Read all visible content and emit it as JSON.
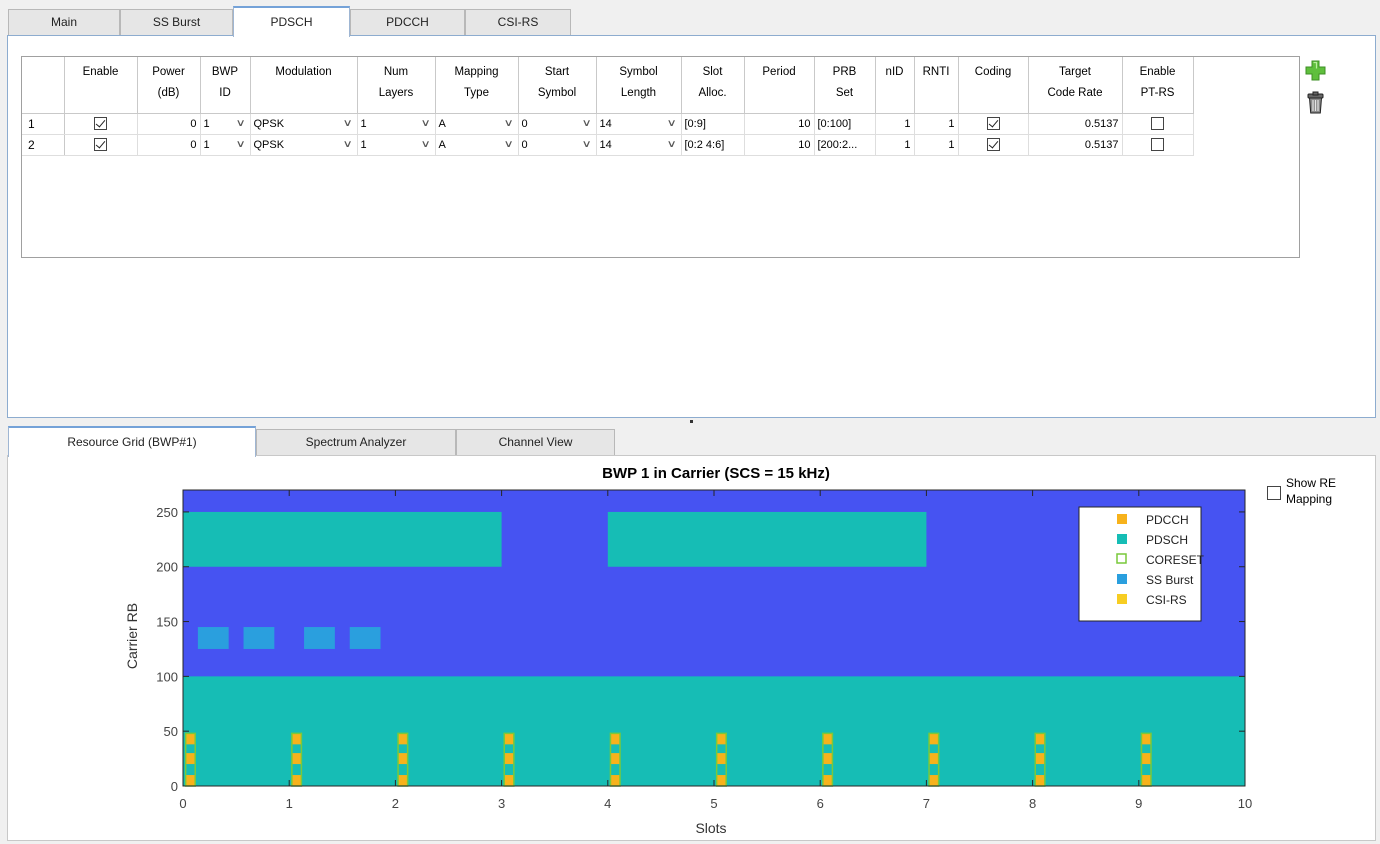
{
  "top_tabs": [
    {
      "label": "Main",
      "active": false
    },
    {
      "label": "SS Burst",
      "active": false
    },
    {
      "label": "PDSCH",
      "active": true
    },
    {
      "label": "PDCCH",
      "active": false
    },
    {
      "label": "CSI-RS",
      "active": false
    }
  ],
  "pdsch_table": {
    "headers": [
      [
        "Enable"
      ],
      [
        "Power",
        "(dB)"
      ],
      [
        "BWP",
        "ID"
      ],
      [
        "Modulation"
      ],
      [
        "Num",
        "Layers"
      ],
      [
        "Mapping",
        "Type"
      ],
      [
        "Start",
        "Symbol"
      ],
      [
        "Symbol",
        "Length"
      ],
      [
        "Slot",
        "Alloc."
      ],
      [
        "Period"
      ],
      [
        "PRB",
        "Set"
      ],
      [
        "nID"
      ],
      [
        "RNTI"
      ],
      [
        "Coding"
      ],
      [
        "Target",
        "Code Rate"
      ],
      [
        "Enable",
        "PT-RS"
      ]
    ],
    "rows": [
      {
        "row": "1",
        "enable": true,
        "power": "0",
        "bwp_id": "1",
        "modulation": "QPSK",
        "num_layers": "1",
        "mapping_type": "A",
        "start_symbol": "0",
        "symbol_length": "14",
        "slot_alloc": "[0:9]",
        "period": "10",
        "prb_set": "[0:100]",
        "nid": "1",
        "rnti": "1",
        "coding": true,
        "target_code_rate": "0.5137",
        "enable_ptrs": false
      },
      {
        "row": "2",
        "enable": true,
        "power": "0",
        "bwp_id": "1",
        "modulation": "QPSK",
        "num_layers": "1",
        "mapping_type": "A",
        "start_symbol": "0",
        "symbol_length": "14",
        "slot_alloc": "[0:2 4:6]",
        "period": "10",
        "prb_set": "[200:2...",
        "nid": "1",
        "rnti": "1",
        "coding": true,
        "target_code_rate": "0.5137",
        "enable_ptrs": false
      }
    ]
  },
  "buttons": {
    "add": "plus-icon",
    "delete": "trash-icon"
  },
  "bottom_tabs": [
    {
      "label": "Resource Grid (BWP#1)",
      "active": true
    },
    {
      "label": "Spectrum Analyzer",
      "active": false
    },
    {
      "label": "Channel View",
      "active": false
    }
  ],
  "show_re_mapping": {
    "label_line1": "Show RE",
    "label_line2": "Mapping",
    "checked": false
  },
  "chart_data": {
    "type": "heatmap",
    "title": "BWP 1 in Carrier (SCS = 15 kHz)",
    "xlabel": "Slots",
    "ylabel": "Carrier RB",
    "xlim": [
      0,
      10
    ],
    "ylim": [
      0,
      270
    ],
    "xticks": [
      0,
      1,
      2,
      3,
      4,
      5,
      6,
      7,
      8,
      9,
      10
    ],
    "yticks": [
      0,
      50,
      100,
      150,
      200,
      250
    ],
    "background_color": "#4653f2",
    "legend": {
      "placement": "top-right",
      "entries": [
        {
          "name": "PDCCH",
          "color": "#f7b21b",
          "style": "filled"
        },
        {
          "name": "PDSCH",
          "color": "#16bdb5",
          "style": "filled"
        },
        {
          "name": "CORESET",
          "color": "#79c93a",
          "style": "outline"
        },
        {
          "name": "SS Burst",
          "color": "#2a9fde",
          "style": "filled"
        },
        {
          "name": "CSI-RS",
          "color": "#f7cd22",
          "style": "filled"
        }
      ]
    },
    "pdsch_regions": [
      {
        "slots": [
          0,
          10
        ],
        "rb": [
          0,
          100
        ]
      },
      {
        "slots": [
          0,
          3
        ],
        "rb": [
          200,
          250
        ]
      },
      {
        "slots": [
          4,
          7
        ],
        "rb": [
          200,
          250
        ]
      }
    ],
    "ssburst_blocks": [
      {
        "slots": [
          0.14,
          0.43
        ],
        "rb": [
          125,
          145
        ]
      },
      {
        "slots": [
          0.57,
          0.86
        ],
        "rb": [
          125,
          145
        ]
      },
      {
        "slots": [
          1.14,
          1.43
        ],
        "rb": [
          125,
          145
        ]
      },
      {
        "slots": [
          1.57,
          1.86
        ],
        "rb": [
          125,
          145
        ]
      }
    ],
    "coreset_slot_starts": [
      0,
      1,
      2,
      3,
      4,
      5,
      6,
      7,
      8,
      9
    ],
    "coreset": {
      "width_slots": 0.14,
      "rb": [
        0,
        48
      ]
    },
    "pdcch_rb_segments": [
      [
        0,
        10
      ],
      [
        20,
        30
      ],
      [
        38,
        48
      ]
    ]
  }
}
